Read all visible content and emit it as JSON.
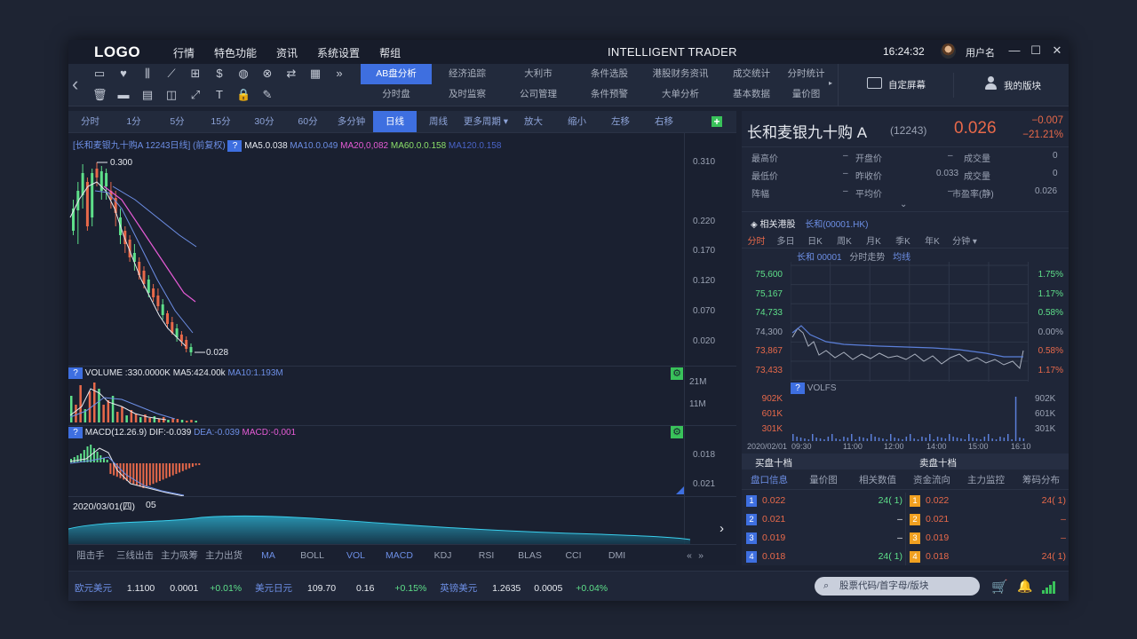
{
  "app": {
    "logo": "LOGO",
    "title": "INTELLIGENT TRADER",
    "time": "16:24:32",
    "username": "用户名",
    "menu": [
      "行情",
      "特色功能",
      "资讯",
      "系统设置",
      "帮组"
    ]
  },
  "toolbar": {
    "tabs_top": [
      "AB盘分析",
      "经济追踪",
      "大利市",
      "条件选股",
      "港股财务资讯",
      "成交统计",
      "分时统计"
    ],
    "tabs_bottom": [
      "分时盘",
      "及时监察",
      "公司管理",
      "条件预警",
      "大单分析",
      "基本数据",
      "量价图"
    ],
    "custom_screen": "自定屏幕",
    "my_blocks": "我的版块"
  },
  "periods": [
    "分时",
    "1分",
    "5分",
    "15分",
    "30分",
    "60分",
    "多分钟",
    "日线",
    "周线",
    "更多周期 ▾",
    "放大",
    "缩小",
    "左移",
    "右移"
  ],
  "main_chart": {
    "caption": "[长和麦银九十购A 12243日线] (前复权)",
    "ma5": "MA5.0.038",
    "ma10": "MA10.0.049",
    "ma20": "MA20,0,082",
    "ma60": "MA60.0.0.158",
    "ma120": "MA120.0.158",
    "high_label": "0.300",
    "low_label": "0.028",
    "y_ticks": [
      "0.310",
      "0.220",
      "0.170",
      "0.120",
      "0.070",
      "0.020"
    ]
  },
  "volume": {
    "label": "VOLUME :330.0000K",
    "ma5": "MA5:424.00k",
    "ma10": "MA10:1.193M",
    "y_ticks": [
      "21M",
      "11M"
    ]
  },
  "macd": {
    "label": "MACD(12.26.9)",
    "dif": "DIF:-0.039",
    "dea": "DEA:-0.039",
    "macd": "MACD:-0,001",
    "y_ticks": [
      "0.018",
      "0.021"
    ]
  },
  "date_strip": {
    "date": "2020/03/01(四)",
    "value": "05"
  },
  "indicators": [
    "阻击手",
    "三线出击",
    "主力吸筹",
    "主力出货",
    "MA",
    "BOLL",
    "VOL",
    "MACD",
    "KDJ",
    "RSI",
    "BLAS",
    "CCI",
    "DMI"
  ],
  "quote": {
    "name": "长和麦银九十购 A",
    "code": "(12243)",
    "price": "0.026",
    "change": "−0.007",
    "change_pct": "−21.21%",
    "fields": [
      [
        "最高价",
        "–",
        "开盘价",
        "–",
        "成交量",
        "0"
      ],
      [
        "最低价",
        "–",
        "昨收价",
        "0.033",
        "成交量",
        "0"
      ],
      [
        "阵幅",
        "–",
        "平均价",
        "–",
        "市盈率(静)",
        "0.026"
      ]
    ]
  },
  "related": {
    "title": "相关港股",
    "link": "长和(00001.HK)",
    "periods": [
      "分时",
      "多日",
      "日K",
      "周K",
      "月K",
      "季K",
      "年K",
      "分钟 ▾"
    ],
    "legend_name": "长和 00001",
    "legend_trend": "分时走势",
    "legend_avg": "均线",
    "left_prices": [
      "75,600",
      "75,167",
      "74,733",
      "74,300",
      "73,867",
      "73,433"
    ],
    "right_pcts": [
      "1.75%",
      "1.17%",
      "0.58%",
      "0.00%",
      "0.58%",
      "1.17%"
    ],
    "vol_label": "VOLFS",
    "vol_ticks": [
      "902K",
      "601K",
      "301K"
    ],
    "time_ticks": [
      "2020/02/01",
      "09:30",
      "11:00",
      "12:00",
      "14:00",
      "15:00",
      "16:10"
    ]
  },
  "order_book": {
    "buy_title": "买盘十档",
    "sell_title": "卖盘十档",
    "tabs": [
      "盘口信息",
      "量价图",
      "相关数值",
      "资金流向",
      "主力监控",
      "筹码分布"
    ],
    "buy": [
      {
        "level": "1",
        "price": "0.022",
        "vol": "24(  1)"
      },
      {
        "level": "2",
        "price": "0.021",
        "vol": "–"
      },
      {
        "level": "3",
        "price": "0.019",
        "vol": "–"
      },
      {
        "level": "4",
        "price": "0.018",
        "vol": "24(  1)"
      }
    ],
    "sell": [
      {
        "level": "1",
        "price": "0.022",
        "vol": "24(  1)"
      },
      {
        "level": "2",
        "price": "0.021",
        "vol": "–"
      },
      {
        "level": "3",
        "price": "0.019",
        "vol": "–"
      },
      {
        "level": "4",
        "price": "0.018",
        "vol": "24(  1)"
      }
    ]
  },
  "fx": [
    {
      "name": "欧元美元",
      "price": "1.1100",
      "chg": "0.0001",
      "pct": "+0.01%"
    },
    {
      "name": "美元日元",
      "price": "109.70",
      "chg": "0.16",
      "pct": "+0.15%"
    },
    {
      "name": "英镑美元",
      "price": "1.2635",
      "chg": "0.0005",
      "pct": "+0.04%"
    }
  ],
  "search": {
    "placeholder": "股票代码/首字母/版块"
  },
  "colors": {
    "accent": "#3e6fe0",
    "up": "#e8694a",
    "down": "#5ee08a",
    "bg": "#1b2131"
  }
}
